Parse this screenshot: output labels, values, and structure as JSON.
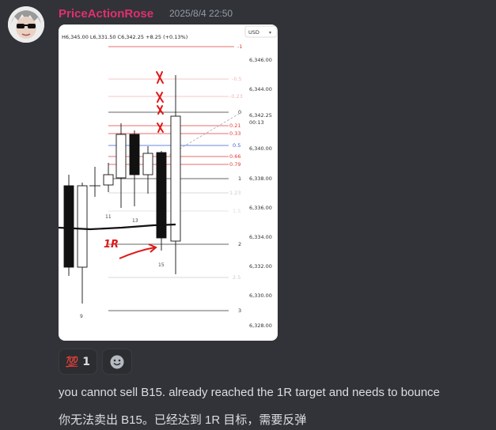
{
  "message": {
    "username": "PriceActionRose",
    "timestamp": "2025/8/4 22:50",
    "line1": "you cannot sell B15. already reached the 1R target and needs to bounce",
    "line2": "你无法卖出 B15。已经达到 1R 目标，需要反弹"
  },
  "reactions": [
    {
      "emoji": "💯",
      "icon": "hundred-points-icon",
      "count": "1"
    },
    {
      "icon": "add-reaction-smiley-icon"
    }
  ],
  "chart": {
    "ohlc_text": "H6,345.00  L6,331.50  C6,342.25  +8.25 (+0.13%)",
    "currency": "USD",
    "price_labels": [
      "6,346.00",
      "6,344.00",
      "6,342.25",
      "00:13",
      "6,340.00",
      "6,338.00",
      "6,336.00",
      "6,334.00",
      "6,332.00",
      "6,330.00",
      "6,328.00"
    ],
    "fib_levels": [
      "-1",
      "-0.5",
      "-0.23",
      "0",
      "0.21",
      "0.33",
      "0.5",
      "0.66",
      "0.79",
      "1",
      "1.23",
      "1.5",
      "2",
      "2.5",
      "3"
    ],
    "bar_labels": [
      "11",
      "13",
      "15",
      "9"
    ],
    "annotation_1r": "1R",
    "colors": {
      "bg": "#323339",
      "username": "#e0306c",
      "fib_red": "#e23b3b",
      "fib_blue": "#3b5bd6"
    }
  }
}
